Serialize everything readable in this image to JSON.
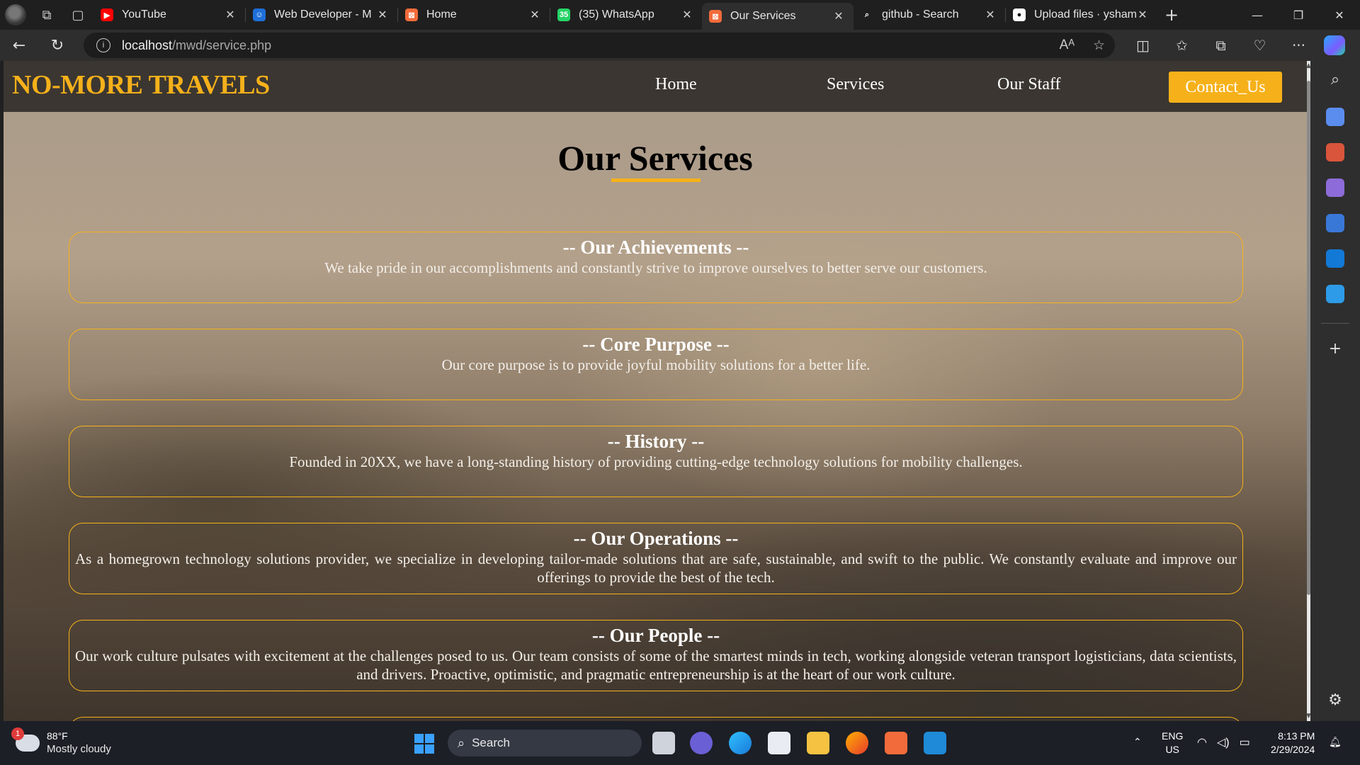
{
  "browser": {
    "tabs": [
      {
        "title": "YouTube",
        "fav_color": "#ff0000",
        "fav_glyph": "▶"
      },
      {
        "title": "Web Developer - M",
        "fav_color": "#1e6fd9",
        "fav_glyph": "☺"
      },
      {
        "title": "Home",
        "fav_color": "#f26b3a",
        "fav_glyph": "⊠"
      },
      {
        "title": "(35) WhatsApp",
        "fav_color": "#25d366",
        "fav_glyph": "35"
      },
      {
        "title": "Our Services",
        "fav_color": "#f26b3a",
        "fav_glyph": "⊠",
        "active": true
      },
      {
        "title": "github - Search",
        "fav_color": "#1f1f1f",
        "fav_glyph": "⌕"
      },
      {
        "title": "Upload files · ysham",
        "fav_color": "#ffffff",
        "fav_glyph": "●"
      }
    ],
    "url_host": "localhost",
    "url_path": "/mwd/service.php"
  },
  "site": {
    "logo": "NO-MORE TRAVELS",
    "nav": [
      "Home",
      "Services",
      "Our Staff"
    ],
    "contact_label": "Contact_Us",
    "page_title": "Our Services",
    "cards": [
      {
        "title": "-- Our Achievements --",
        "text": "We take pride in our accomplishments and constantly strive to improve ourselves to better serve our customers."
      },
      {
        "title": "-- Core Purpose --",
        "text": "Our core purpose is to provide joyful mobility solutions for a better life."
      },
      {
        "title": "-- History --",
        "text": "Founded in 20XX, we have a long-standing history of providing cutting-edge technology solutions for mobility challenges."
      },
      {
        "title": "-- Our Operations --",
        "text": "As a homegrown technology solutions provider, we specialize in developing tailor-made solutions that are safe, sustainable, and swift to the public. We constantly evaluate and improve our offerings to provide the best of the tech."
      },
      {
        "title": "-- Our People --",
        "text": "Our work culture pulsates with excitement at the challenges posed to us. Our team consists of some of the smartest minds in tech, working alongside veteran transport logisticians, data scientists, and drivers. Proactive, optimistic, and pragmatic entrepreneurship is at the heart of our work culture."
      }
    ],
    "accent": "#f6b11a"
  },
  "taskbar": {
    "weather_badge": "1",
    "temp": "88°F",
    "condition": "Mostly cloudy",
    "search_label": "Search",
    "lang_top": "ENG",
    "lang_bottom": "US",
    "time": "8:13 PM",
    "date": "2/29/2024"
  }
}
